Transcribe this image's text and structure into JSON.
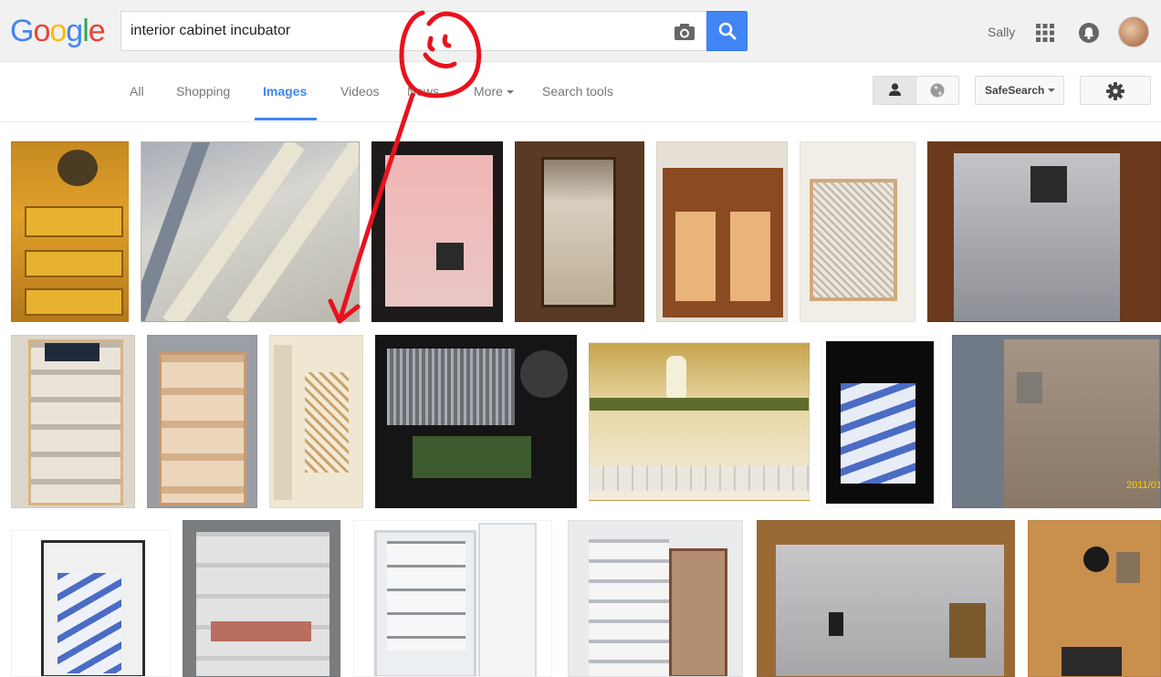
{
  "logo": [
    "G",
    "o",
    "o",
    "g",
    "l",
    "e"
  ],
  "logo_colors": [
    "#4285f4",
    "#ea4335",
    "#fbbc05",
    "#4285f4",
    "#34a853",
    "#ea4335"
  ],
  "search": {
    "query": "interior cabinet incubator"
  },
  "user": {
    "name": "Sally"
  },
  "tabs": [
    {
      "label": "All"
    },
    {
      "label": "Shopping"
    },
    {
      "label": "Images"
    },
    {
      "label": "Videos"
    },
    {
      "label": "News"
    },
    {
      "label": "More"
    },
    {
      "label": "Search tools"
    }
  ],
  "active_tab": "Images",
  "safesearch": {
    "label": "SafeSearch"
  },
  "icons": {
    "camera": "camera-icon",
    "search": "magnifier-icon",
    "apps": "grid-apps-icon",
    "notifications": "bell-icon",
    "person": "person-icon",
    "globe": "globe-icon",
    "settings": "gear-icon"
  },
  "watermark_text": "2011/01/",
  "colors": {
    "accent": "#4285f4",
    "annotation": "#e8121d"
  }
}
